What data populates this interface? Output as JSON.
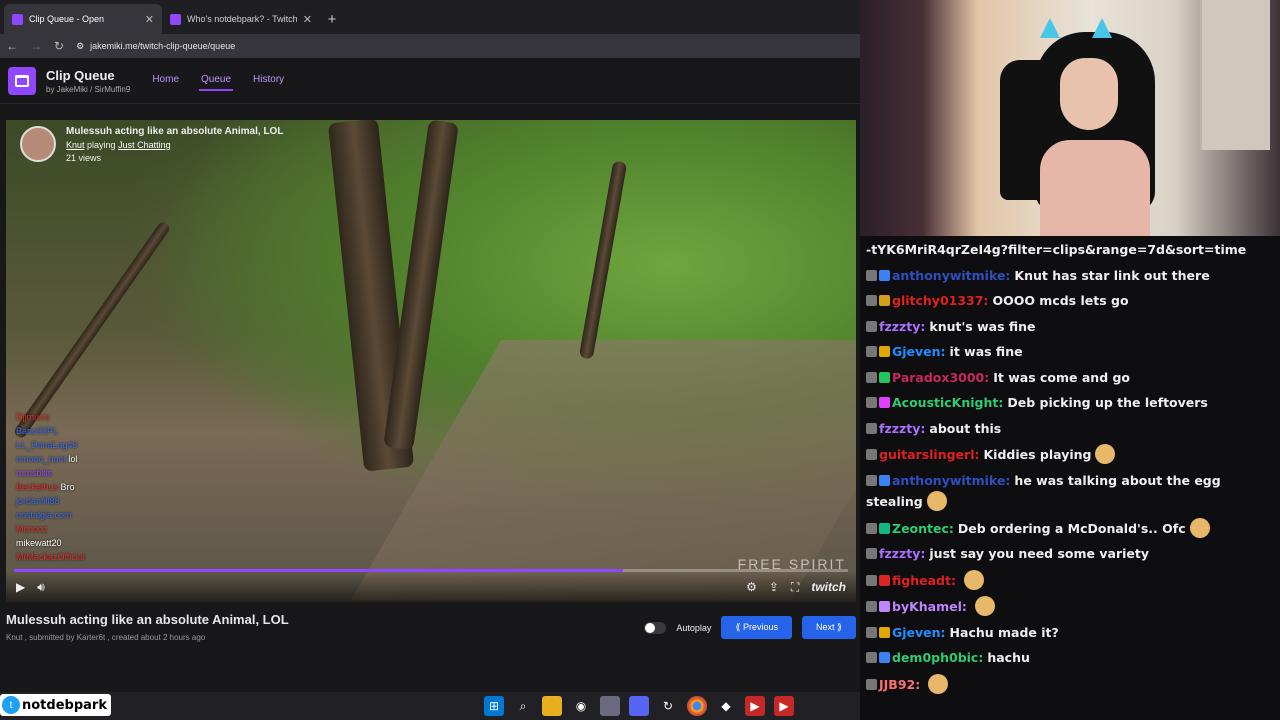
{
  "tabs": [
    {
      "title": "Clip Queue - Open",
      "active": true
    },
    {
      "title": "Who's notdebpark? - Twitch",
      "active": false
    }
  ],
  "url": "jakemiki.me/twitch-clip-queue/queue",
  "app": {
    "title": "Clip Queue",
    "subtitle": "by JakeMiki / SirMuffin9",
    "nav": [
      "Home",
      "Queue",
      "History"
    ],
    "active_nav": "Queue"
  },
  "player": {
    "clip_title": "Mulessuh acting like an absolute Animal, LOL",
    "broadcaster": "Knut",
    "playing_label": "playing",
    "game": "Just Chatting",
    "views": "21 views",
    "watermark": "FREE SPIRIT",
    "brand": "twitch",
    "progress": 0.73,
    "overlay_chat": [
      {
        "user": "Djjmurrs",
        "text": "",
        "color": "#e03030"
      },
      {
        "user": "Bano93PL",
        "text": "",
        "color": "#3a6df0"
      },
      {
        "user": "LL_DanaLag43",
        "text": "",
        "color": "#3a6df0"
      },
      {
        "user": "nmooo_nuot",
        "text": "lol",
        "color": "#3a6df0"
      },
      {
        "user": "rurusbilis",
        "text": "",
        "color": "#9147ff"
      },
      {
        "user": "Beckethus",
        "text": "Bro",
        "color": "#e03030"
      },
      {
        "user": "jordanfill88",
        "text": "",
        "color": "#3a6df0"
      },
      {
        "user": "nostalgia.com",
        "text": "",
        "color": "#3a6df0"
      },
      {
        "user": "Mcnooz",
        "text": "",
        "color": "#e03030"
      },
      {
        "user": "mikewatt20",
        "text": "",
        "color": "#ffffff"
      },
      {
        "user": "MrMackazOfficial",
        "text": "",
        "color": "#e03030"
      }
    ]
  },
  "clip_info": {
    "title": "Mulessuh acting like an absolute Animal, LOL",
    "meta": "Knut , submitted by Karter6t , created about 2 hours ago"
  },
  "actions": {
    "autoplay_label": "Autoplay",
    "prev_label": "Previous",
    "next_label": "Next"
  },
  "chat": [
    {
      "user": "",
      "text": "-tYK6MriR4qrZeI4g?filter=clips&range=7d&sort=time",
      "color": "#ffffff",
      "badge": ""
    },
    {
      "user": "anthonywitmike:",
      "text": "Knut has star link out there",
      "color": "#2f4fbf",
      "badge": "#3b82f6"
    },
    {
      "user": "glitchy01337:",
      "text": "OOOO mcds lets go",
      "color": "#e02020",
      "badge": "#d4a017"
    },
    {
      "user": "fzzzty:",
      "text": "knut's was fine",
      "color": "#a970ff",
      "badge": ""
    },
    {
      "user": "Gjeven:",
      "text": "it was fine",
      "color": "#1e90ff",
      "badge": "#e0a800"
    },
    {
      "user": "Paradox3000:",
      "text": "It was come and go",
      "color": "#c8285a",
      "badge": "#22c55e"
    },
    {
      "user": "AcousticKnight:",
      "text": "Deb picking up the leftovers",
      "color": "#2ecc71",
      "badge": "#e040fb"
    },
    {
      "user": "fzzzty:",
      "text": "about this",
      "color": "#a970ff",
      "badge": ""
    },
    {
      "user": "guitarslingerl:",
      "text": "Kiddies playing",
      "color": "#e02020",
      "badge": ""
    },
    {
      "user": "anthonywitmike:",
      "text": "he was talking about the egg stealing",
      "color": "#2f4fbf",
      "badge": "#3b82f6"
    },
    {
      "user": "Zeontec:",
      "text": "Deb ordering a McDonald's.. Ofc",
      "color": "#2ecc71",
      "badge": "#10b981"
    },
    {
      "user": "fzzzty:",
      "text": "just say you need some variety",
      "color": "#a970ff",
      "badge": ""
    },
    {
      "user": "figheadt:",
      "text": "",
      "color": "#e02020",
      "badge": "#dc2626"
    },
    {
      "user": "byKhamel:",
      "text": "",
      "color": "#c084fc",
      "badge": "#c084fc"
    },
    {
      "user": "Gjeven:",
      "text": "Hachu made it?",
      "color": "#1e90ff",
      "badge": "#e0a800"
    },
    {
      "user": "dem0ph0bic:",
      "text": "hachu",
      "color": "#2ecc71",
      "badge": "#3b82f6"
    },
    {
      "user": "JJB92:",
      "text": "",
      "color": "#f87171",
      "badge": ""
    }
  ],
  "taskbar": {
    "handle": "notdebpark"
  }
}
